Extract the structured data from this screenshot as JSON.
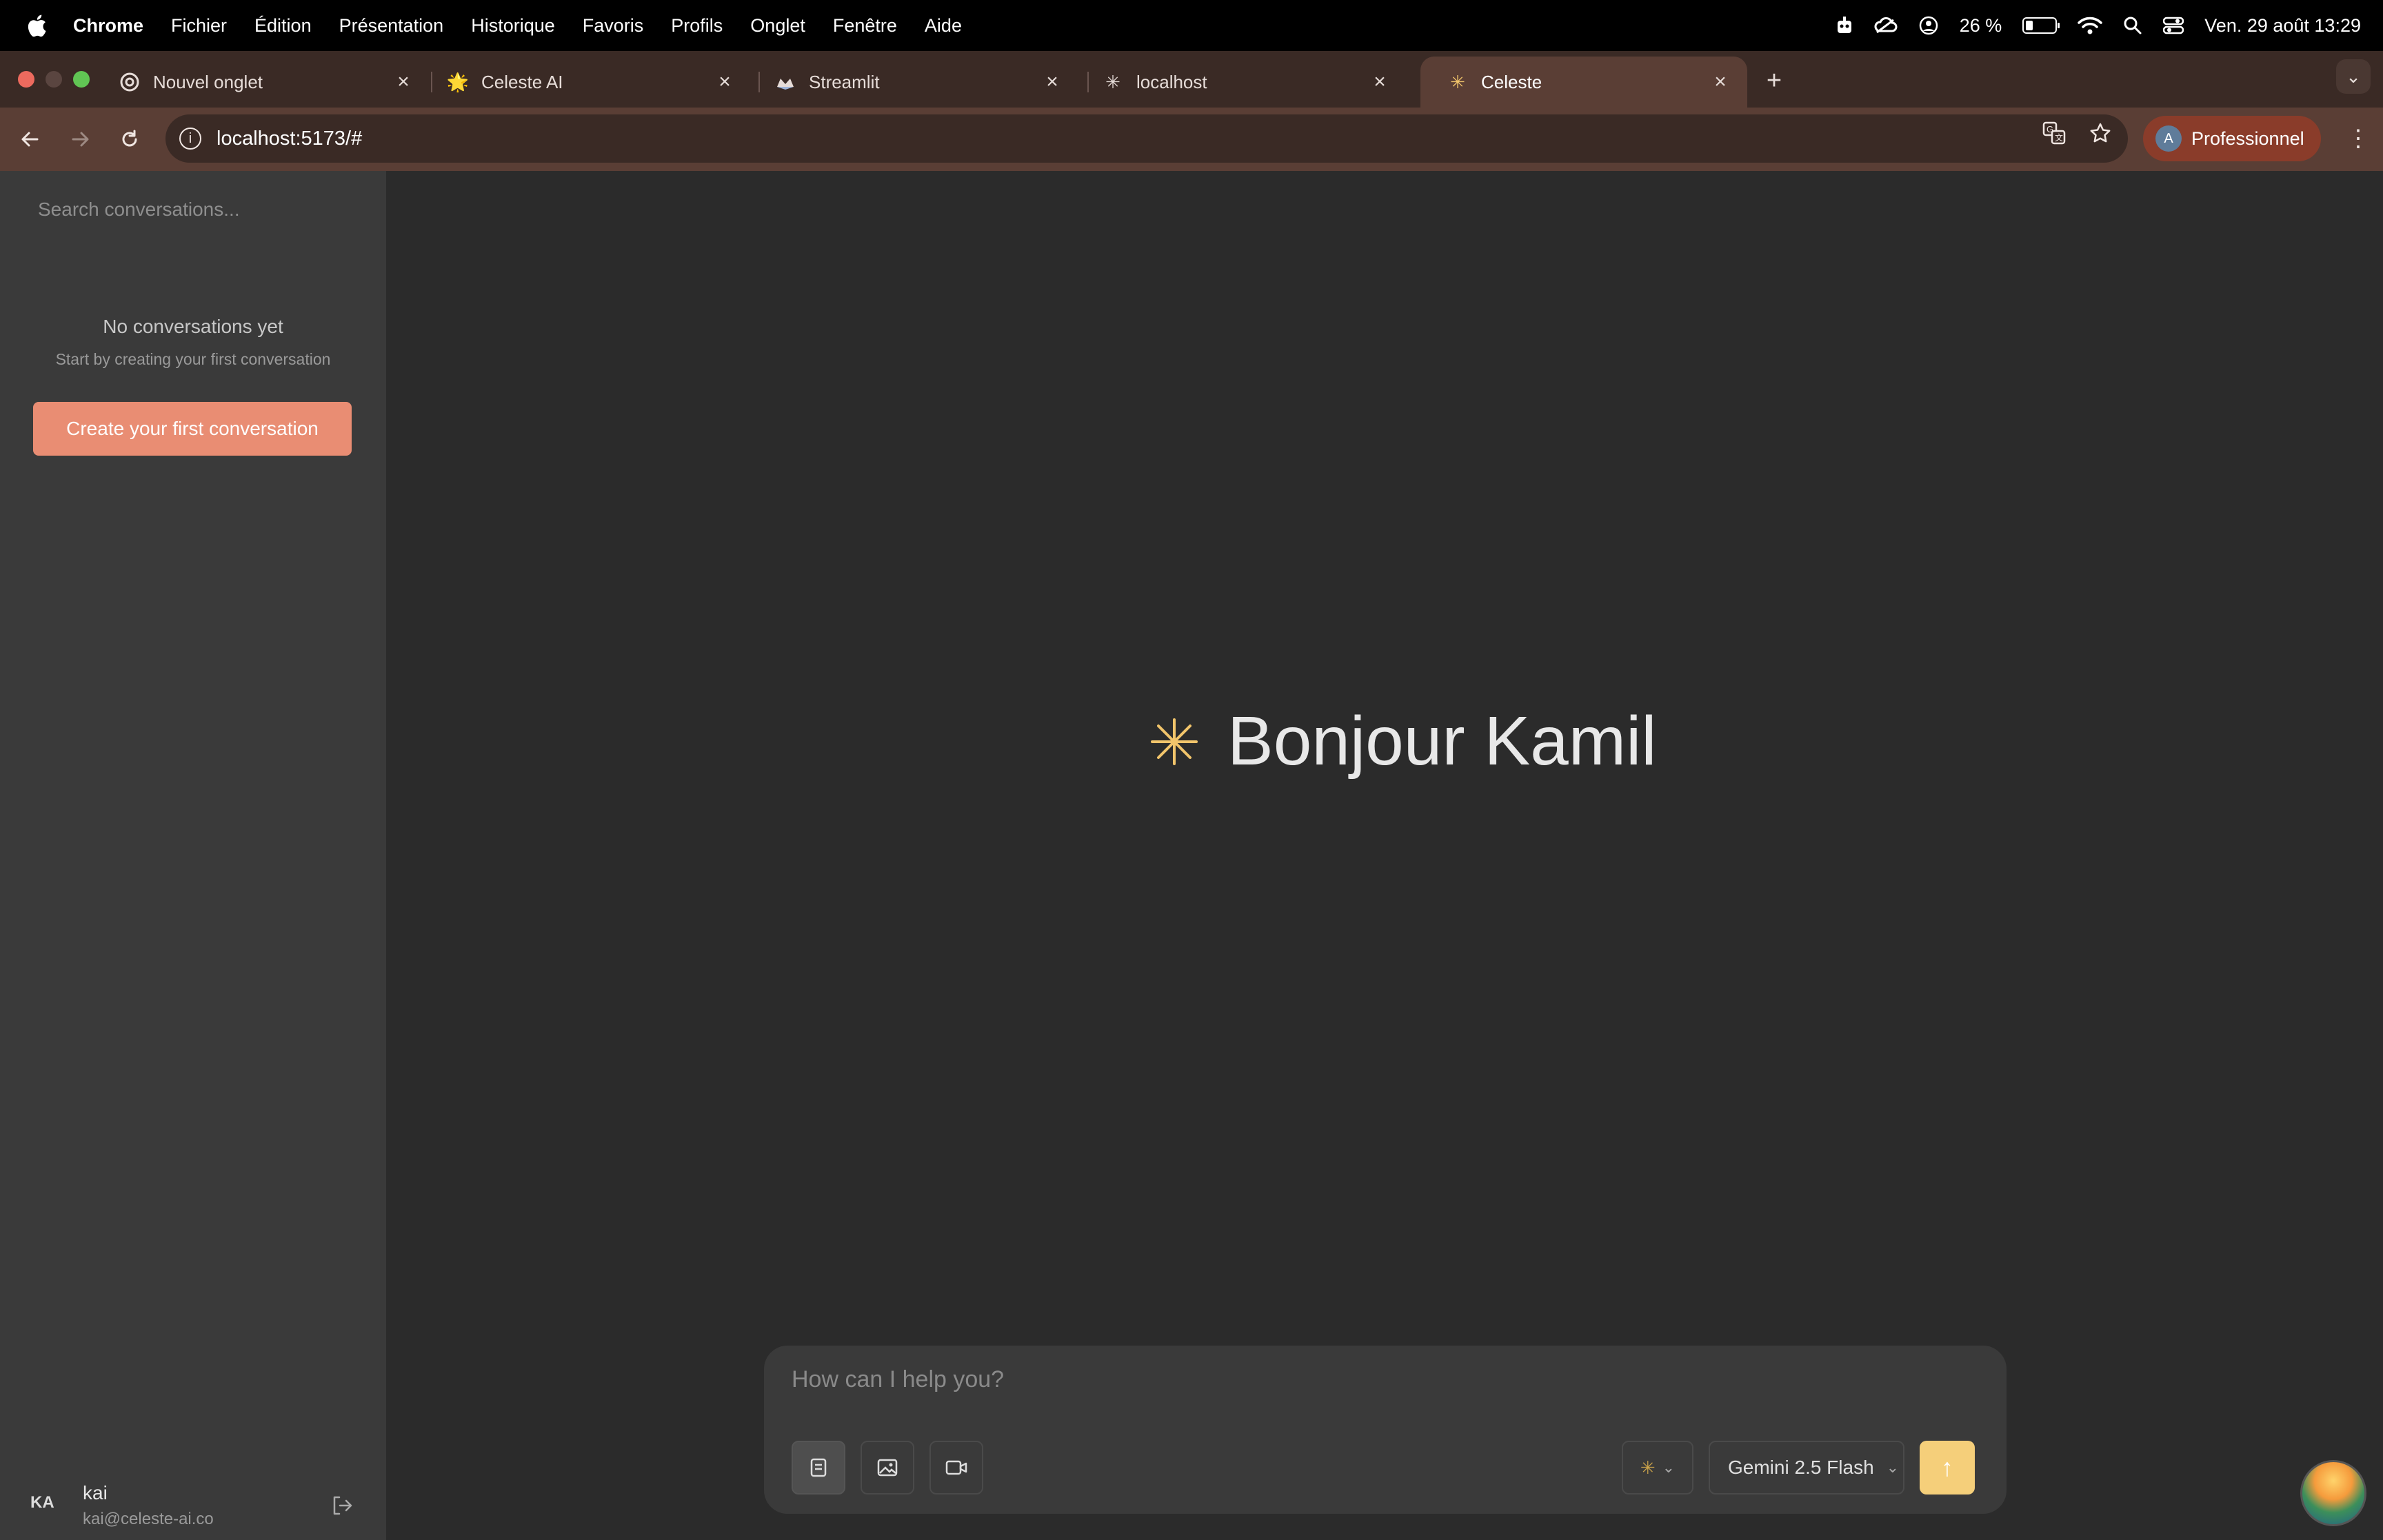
{
  "menubar": {
    "app": "Chrome",
    "items": [
      "Fichier",
      "Édition",
      "Présentation",
      "Historique",
      "Favoris",
      "Profils",
      "Onglet",
      "Fenêtre",
      "Aide"
    ],
    "battery_text": "26 %",
    "battery_level": 0.26,
    "datetime": "Ven. 29 août  13:29"
  },
  "tabs": [
    {
      "title": "Nouvel onglet",
      "icon": "chrome-icon"
    },
    {
      "title": "Celeste AI",
      "icon": "sun-icon"
    },
    {
      "title": "Streamlit",
      "icon": "streamlit-icon"
    },
    {
      "title": "localhost",
      "icon": "sparkle-icon"
    },
    {
      "title": "Celeste",
      "icon": "sparkle-icon",
      "active": true
    }
  ],
  "toolbar": {
    "url": "localhost:5173/#",
    "profile_initial": "A",
    "profile_label": "Professionnel"
  },
  "sidebar": {
    "search_placeholder": "Search conversations...",
    "empty_title": "No conversations yet",
    "empty_subtitle": "Start by creating your first conversation",
    "create_button": "Create your first conversation",
    "user": {
      "initials": "KA",
      "name": "kai",
      "email": "kai@celeste-ai.co"
    }
  },
  "main": {
    "greeting": "Bonjour Kamil",
    "composer": {
      "placeholder": "How can I help you?",
      "model": "Gemini 2.5 Flash",
      "send_symbol": "↑"
    }
  },
  "colors": {
    "accent": "#e98d73",
    "send": "#f5cf7a",
    "star": "#f2c56b",
    "chrome_frame": "#5a3e35"
  }
}
